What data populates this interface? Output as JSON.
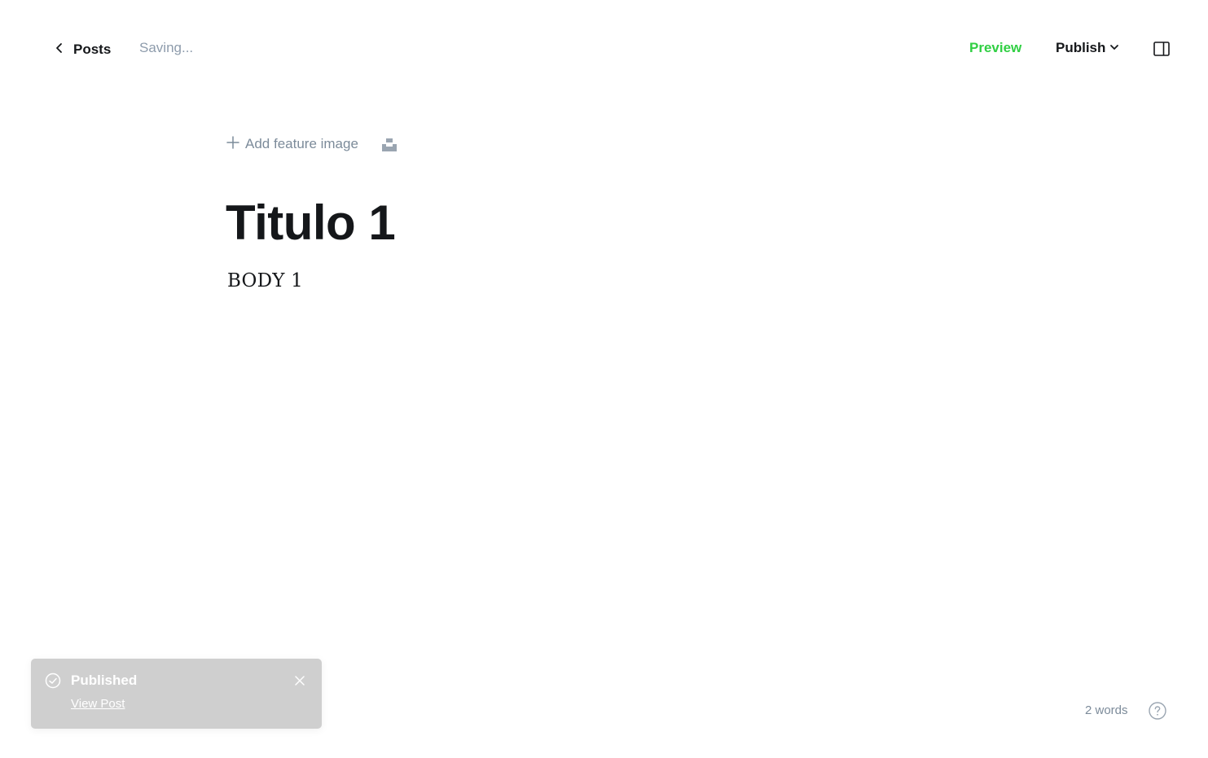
{
  "header": {
    "back_label": "Posts",
    "status": "Saving...",
    "preview_label": "Preview",
    "publish_label": "Publish"
  },
  "editor": {
    "add_feature_image_label": "Add feature image",
    "title": "Titulo 1",
    "body": "BODY 1"
  },
  "toast": {
    "title": "Published",
    "link_label": "View Post"
  },
  "footer": {
    "word_count": "2 words"
  },
  "colors": {
    "accent_green": "#30cf43",
    "muted_text": "#8e9cac",
    "toast_bg": "#cfcfcf"
  },
  "icons": [
    "chevron-left-icon",
    "chevron-down-icon",
    "sidebar-toggle-icon",
    "plus-icon",
    "unsplash-icon",
    "check-circle-icon",
    "close-icon",
    "help-icon"
  ]
}
